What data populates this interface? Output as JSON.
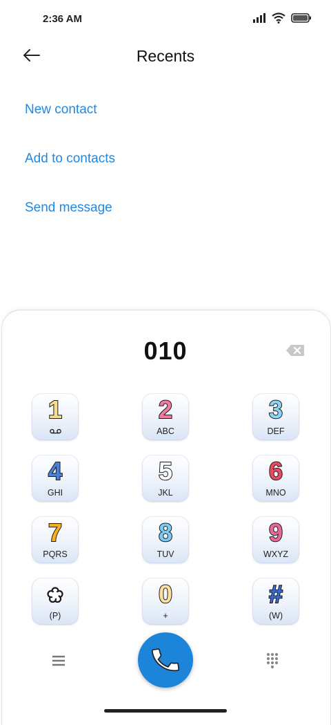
{
  "status_bar": {
    "time": "2:36 AM",
    "icons": [
      "signal-icon",
      "wifi-icon",
      "battery-icon"
    ]
  },
  "header": {
    "back_icon": "arrow-left-icon",
    "title": "Recents"
  },
  "actions": {
    "new_contact": "New contact",
    "add_to_contacts": "Add to contacts",
    "send_message": "Send message"
  },
  "colors": {
    "accent": "#1e88e5",
    "call_button": "#1c85d9"
  },
  "dialer": {
    "number": "010",
    "backspace_icon": "backspace-icon",
    "keys": [
      {
        "digit": "1",
        "sub": "",
        "sub_icon": "voicemail-icon",
        "color": "#f7dc8f"
      },
      {
        "digit": "2",
        "sub": "ABC",
        "color": "#f07aa0"
      },
      {
        "digit": "3",
        "sub": "DEF",
        "color": "#8fd3f4"
      },
      {
        "digit": "4",
        "sub": "GHI",
        "color": "#4a80d8"
      },
      {
        "digit": "5",
        "sub": "JKL",
        "color": "#ffffff"
      },
      {
        "digit": "6",
        "sub": "MNO",
        "color": "#ea4a62"
      },
      {
        "digit": "7",
        "sub": "PQRS",
        "color": "#f7b21b"
      },
      {
        "digit": "8",
        "sub": "TUV",
        "color": "#7ccbf2"
      },
      {
        "digit": "9",
        "sub": "WXYZ",
        "color": "#e86a98"
      },
      {
        "digit": "",
        "symbol_icon": "flower-star-icon",
        "sub": "(P)",
        "color": "#ffffff"
      },
      {
        "digit": "0",
        "sub": "+",
        "color": "#fbe0a0"
      },
      {
        "digit": "#",
        "sub": "(W)",
        "color": "#3b6ad3"
      }
    ],
    "menu_icon": "menu-icon",
    "call_icon": "phone-icon",
    "dialpad_icon": "dialpad-icon"
  }
}
